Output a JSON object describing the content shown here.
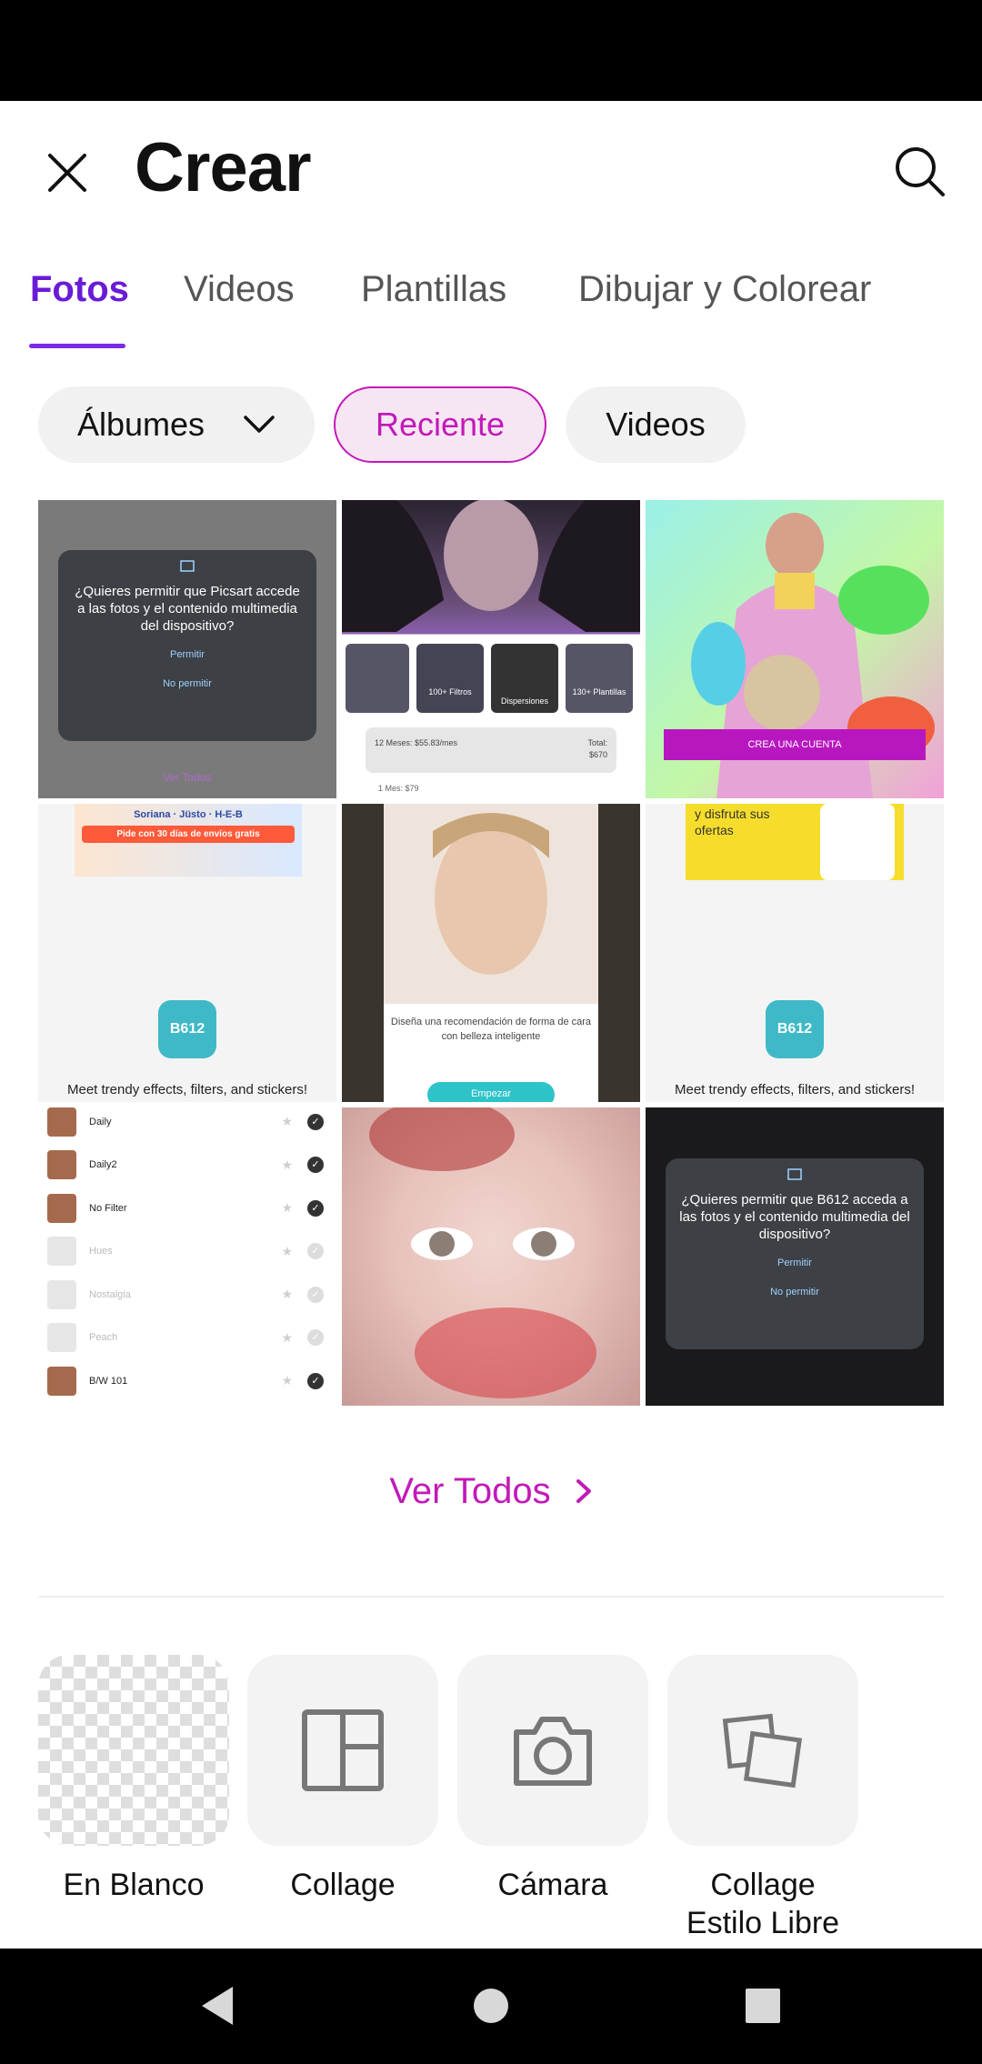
{
  "header": {
    "title": "Crear",
    "close_icon": "close-icon",
    "search_icon": "search-icon"
  },
  "tabs": [
    {
      "label": "Fotos",
      "active": true
    },
    {
      "label": "Videos",
      "active": false
    },
    {
      "label": "Plantillas",
      "active": false
    },
    {
      "label": "Dibujar y Colorear",
      "active": false
    }
  ],
  "filters": {
    "albums": "Álbumes",
    "recent": "Reciente",
    "videos": "Videos"
  },
  "grid": {
    "tile1": {
      "dialog_text": "¿Quieres permitir que Picsart accede a las fotos y el contenido multimedia del dispositivo?",
      "allow": "Permitir",
      "deny": "No permitir",
      "footer": "Ver Todos"
    },
    "tile2": {
      "filters": "100+ Filtros",
      "dispersions": "Dispersiones",
      "templates": "130+ Plantillas",
      "plan": "12 Meses: $55.83/mes",
      "total_label": "Total:",
      "total_value": "$670",
      "plan2": "1 Mes: $79"
    },
    "tile3": {
      "cta": "CREA UNA CUENTA"
    },
    "tile4": {
      "brands": "Soriana · Jüsto · H-E-B",
      "promo": "Pide con 30 días de envíos gratis",
      "logo": "B612",
      "caption": "Meet trendy effects, filters, and stickers!"
    },
    "tile5": {
      "text": "Diseña una recomendación de forma de cara con belleza inteligente",
      "button": "Empezar"
    },
    "tile6": {
      "promo": "y disfruta sus ofertas",
      "logo": "B612",
      "caption": "Meet trendy effects, filters, and stickers!"
    },
    "tile7": {
      "rows": [
        "Daily",
        "Daily2",
        "No Filter",
        "Hues",
        "Nostalgia",
        "Peach",
        "B/W 101"
      ]
    },
    "tile9": {
      "dialog_text": "¿Quieres permitir que B612 acceda a las fotos y el contenido multimedia del dispositivo?",
      "allow": "Permitir",
      "deny": "No permitir"
    }
  },
  "ver_todos": "Ver Todos",
  "tools": [
    {
      "label": "En Blanco",
      "icon": "transparent-canvas-icon"
    },
    {
      "label": "Collage",
      "icon": "collage-grid-icon"
    },
    {
      "label": "Cámara",
      "icon": "camera-icon"
    },
    {
      "label": "Collage\nEstilo Libre",
      "icon": "freestyle-collage-icon"
    }
  ],
  "nav": {
    "back_icon": "back-triangle-icon",
    "home_icon": "home-circle-icon",
    "recents_icon": "recents-square-icon"
  },
  "colors": {
    "accent": "#c21ab8",
    "tab_active": "#6a1bd6"
  }
}
